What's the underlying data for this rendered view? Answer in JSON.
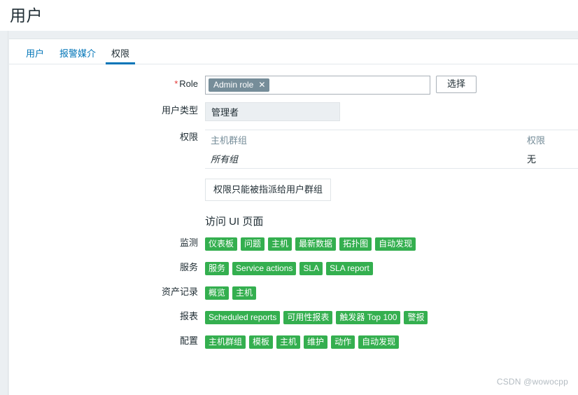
{
  "header": {
    "title": "用户"
  },
  "tabs": [
    {
      "label": "用户",
      "active": false
    },
    {
      "label": "报警媒介",
      "active": false
    },
    {
      "label": "权限",
      "active": true
    }
  ],
  "form": {
    "role": {
      "label": "Role",
      "required_marker": "*",
      "token": "Admin role",
      "token_remove_icon": "✕",
      "select_button": "选择"
    },
    "user_type": {
      "label": "用户类型",
      "value": "管理者"
    },
    "permissions": {
      "label": "权限",
      "columns": [
        "主机群组",
        "权限"
      ],
      "rows": [
        {
          "group": "所有组",
          "permission": "无"
        }
      ]
    },
    "notice": "权限只能被指派给用户群组"
  },
  "ui_access": {
    "title": "访问 UI 页面",
    "sections": [
      {
        "label": "监测",
        "badges": [
          "仪表板",
          "问题",
          "主机",
          "最新数据",
          "拓扑图",
          "自动发现"
        ]
      },
      {
        "label": "服务",
        "badges": [
          "服务",
          "Service actions",
          "SLA",
          "SLA report"
        ]
      },
      {
        "label": "资产记录",
        "badges": [
          "概览",
          "主机"
        ]
      },
      {
        "label": "报表",
        "badges": [
          "Scheduled reports",
          "可用性报表",
          "触发器 Top 100",
          "警报"
        ]
      },
      {
        "label": "配置",
        "badges": [
          "主机群组",
          "模板",
          "主机",
          "维护",
          "动作",
          "自动发现"
        ]
      }
    ]
  },
  "watermark": "CSDN @wowocpp",
  "colors": {
    "accent": "#0275b8",
    "badge_green": "#34af4f",
    "token_grey": "#768d99",
    "required_red": "#e33734",
    "page_bg": "#ebeff2"
  }
}
